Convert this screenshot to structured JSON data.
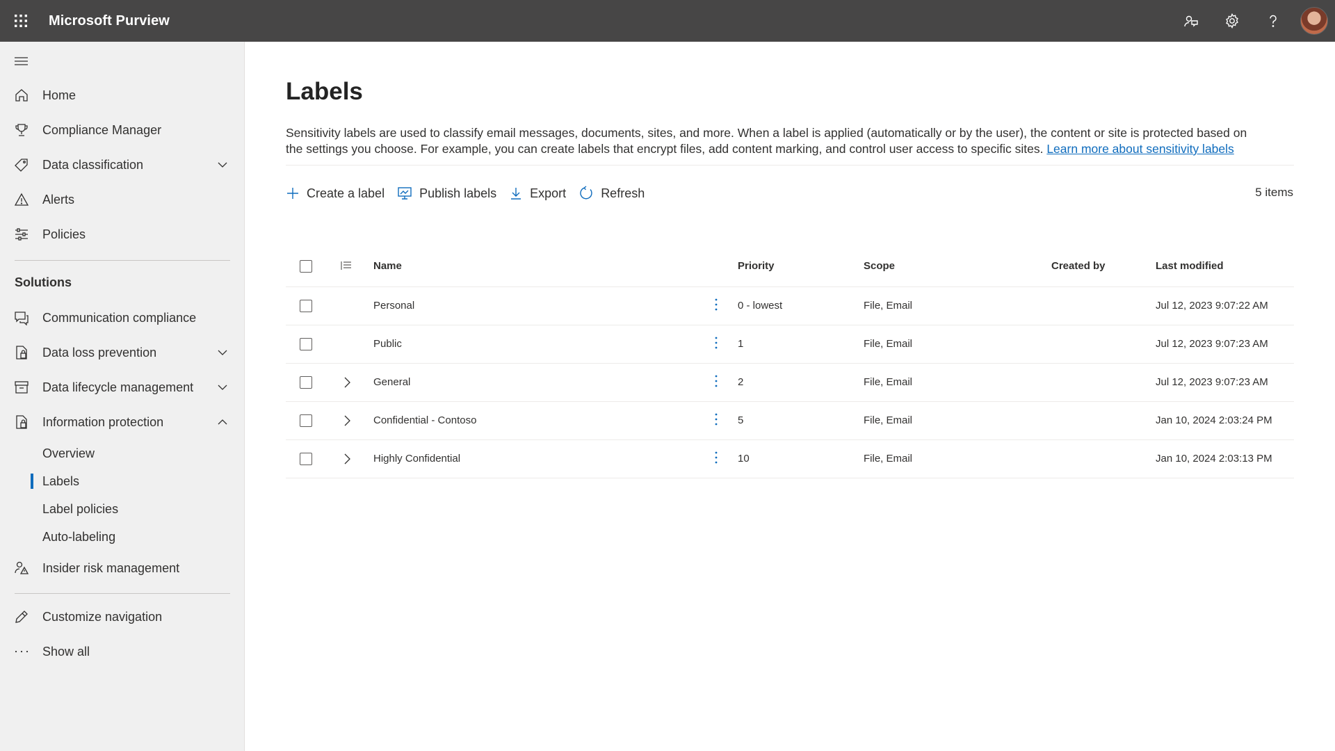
{
  "app": {
    "title": "Microsoft Purview"
  },
  "topbar": {
    "icons": [
      "community-icon",
      "gear-icon",
      "help-icon"
    ]
  },
  "sidebar": {
    "primary": [
      {
        "label": "Home",
        "icon": "home-icon"
      },
      {
        "label": "Compliance Manager",
        "icon": "trophy-icon"
      },
      {
        "label": "Data classification",
        "icon": "tag-icon",
        "expandable": true
      },
      {
        "label": "Alerts",
        "icon": "alert-icon"
      },
      {
        "label": "Policies",
        "icon": "sliders-icon"
      }
    ],
    "solutions_title": "Solutions",
    "solutions": [
      {
        "label": "Communication compliance",
        "icon": "chat-icon"
      },
      {
        "label": "Data loss prevention",
        "icon": "dlp-icon",
        "expandable": true
      },
      {
        "label": "Data lifecycle management",
        "icon": "archive-icon",
        "expandable": true
      },
      {
        "label": "Information protection",
        "icon": "lock-doc-icon",
        "expanded": true
      }
    ],
    "info_protection_sub": [
      {
        "label": "Overview"
      },
      {
        "label": "Labels",
        "selected": true
      },
      {
        "label": "Label policies"
      },
      {
        "label": "Auto-labeling"
      }
    ],
    "insider": {
      "label": "Insider risk management",
      "icon": "person-warning-icon"
    },
    "customize": {
      "label": "Customize navigation",
      "icon": "pencil-icon"
    },
    "show_all": {
      "label": "Show all",
      "icon": "more-icon"
    }
  },
  "main": {
    "title": "Labels",
    "description": "Sensitivity labels are used to classify email messages, documents, sites, and more. When a label is applied (automatically or by the user), the content or site is protected based on the settings you choose. For example, you can create labels that encrypt files, add content marking, and control user access to specific sites.",
    "learn_more": "Learn more about sensitivity labels",
    "commands": {
      "create": "Create a label",
      "publish": "Publish labels",
      "export": "Export",
      "refresh": "Refresh"
    },
    "item_count": "5 items",
    "columns": {
      "name": "Name",
      "priority": "Priority",
      "scope": "Scope",
      "created_by": "Created by",
      "last_modified": "Last modified"
    },
    "rows": [
      {
        "name": "Personal",
        "priority": "0 - lowest",
        "scope": "File, Email",
        "created_by": "",
        "last_modified": "Jul 12, 2023 9:07:22 AM",
        "expandable": false
      },
      {
        "name": "Public",
        "priority": "1",
        "scope": "File, Email",
        "created_by": "",
        "last_modified": "Jul 12, 2023 9:07:23 AM",
        "expandable": false
      },
      {
        "name": "General",
        "priority": "2",
        "scope": "File, Email",
        "created_by": "",
        "last_modified": "Jul 12, 2023 9:07:23 AM",
        "expandable": true
      },
      {
        "name": "Confidential - Contoso",
        "priority": "5",
        "scope": "File, Email",
        "created_by": "",
        "last_modified": "Jan 10, 2024 2:03:24 PM",
        "expandable": true
      },
      {
        "name": "Highly Confidential",
        "priority": "10",
        "scope": "File, Email",
        "created_by": "",
        "last_modified": "Jan 10, 2024 2:03:13 PM",
        "expandable": true
      }
    ]
  },
  "colors": {
    "topbar": "#474646",
    "sidebar": "#f0f0f0",
    "accent": "#0f6cbd"
  }
}
